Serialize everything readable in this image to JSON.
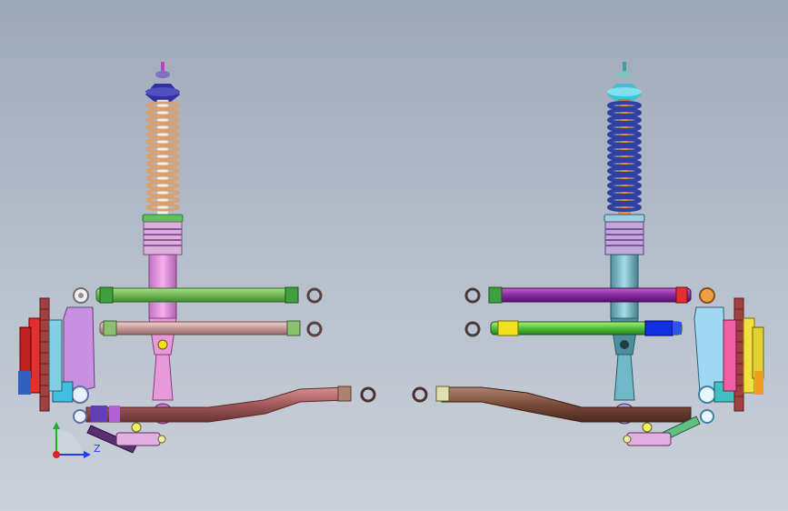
{
  "viewport": {
    "background_top": "#9ea9b9",
    "background_bottom": "#cbd1da"
  },
  "triad": {
    "axis_label": "Z",
    "colors": {
      "x": "#e02020",
      "y": "#20b020",
      "z": "#2040e0"
    }
  },
  "assemblies": [
    {
      "name": "left-suspension",
      "colors": {
        "spring": "#d9a070",
        "strut_body": "#e79ad9",
        "upper_link": "#7fcf60",
        "mid_link": "#d3a0a0",
        "lower_arm": "#b06262",
        "knuckle": "#c890e0",
        "rotor": "#a04040",
        "caliper": "#e03030"
      }
    },
    {
      "name": "right-suspension",
      "colors": {
        "spring": "#3040a0",
        "strut_body": "#6fb8c8",
        "upper_link": "#8a2aa0",
        "mid_link": "#40c040",
        "lower_arm": "#7a4a3a",
        "knuckle": "#9fd8f0",
        "rotor": "#a04040",
        "caliper": "#f0e040"
      }
    }
  ]
}
